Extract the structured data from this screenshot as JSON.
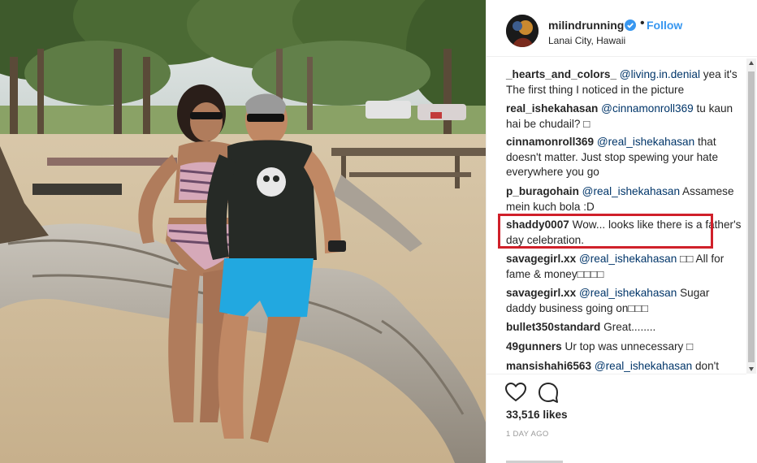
{
  "post": {
    "username": "milindrunning",
    "verified": true,
    "separator": "•",
    "follow_label": "Follow",
    "location": "Lanai City, Hawaii",
    "likes": "33,516 likes",
    "time": "1 DAY AGO"
  },
  "comments": [
    {
      "user": "_hearts_and_colors_",
      "mention": "@living.in.denial",
      "text": " yea it's The first thing I noticed in the picture"
    },
    {
      "user": "real_ishekahasan",
      "mention": "@cinnamonroll369",
      "text": " tu kaun hai be chudail? □"
    },
    {
      "user": "cinnamonroll369",
      "mention": "@real_ishekahasan",
      "text": " that doesn't matter. Just stop spewing your hate everywhere you go"
    },
    {
      "user": "p_buragohain",
      "mention": "@real_ishekahasan",
      "text": " Assamese mein kuch bola :D"
    },
    {
      "user": "shaddy0007",
      "mention": "",
      "text": "Wow... looks like there is a father's day celebration."
    },
    {
      "user": "savagegirl.xx",
      "mention": "@real_ishekahasan",
      "text": " □□ All for fame & money□□□□"
    },
    {
      "user": "savagegirl.xx",
      "mention": "@real_ishekahasan",
      "text": " Sugar daddy business going on□□□"
    },
    {
      "user": "bullet350standard",
      "mention": "",
      "text": "Great........"
    },
    {
      "user": "49gunners",
      "mention": "",
      "text": "Ur top was unnecessary □"
    },
    {
      "user": "mansishahi6563",
      "mention": "@real_ishekahasan",
      "text": " don't"
    }
  ],
  "icons": {
    "like": "heart-icon",
    "comment": "speech-bubble-icon",
    "verified": "verified-badge-icon"
  },
  "colors": {
    "accent": "#3897f0",
    "mention": "#003569",
    "highlight": "#d0202a",
    "meta": "#999999"
  }
}
